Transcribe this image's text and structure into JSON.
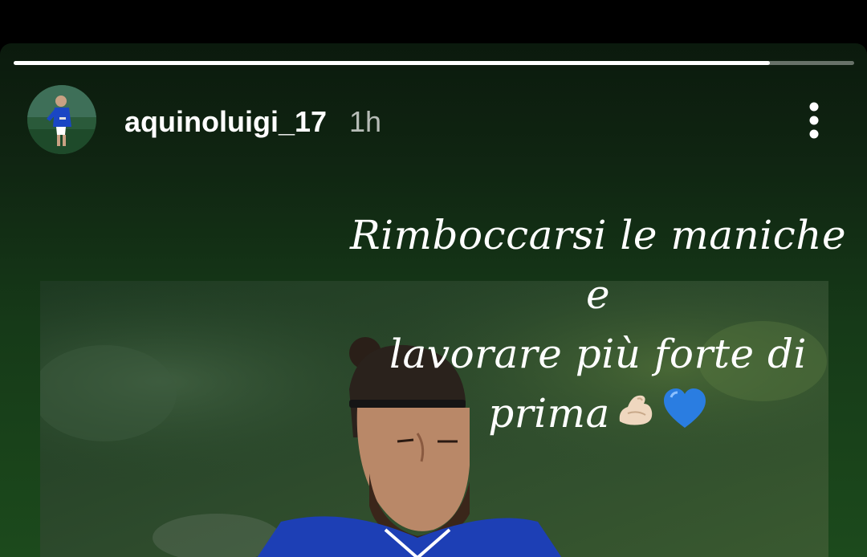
{
  "story": {
    "progress": 0.9,
    "username": "aquinoluigi_17",
    "time": "1h",
    "more_icon": "more-vertical-icon",
    "caption_lines": [
      "Rimboccarsi le maniche e",
      "lavorare più forte di",
      "prima"
    ],
    "caption_emojis": [
      "flexed-biceps-icon",
      "blue-heart-icon"
    ]
  },
  "colors": {
    "background": "#000000",
    "story_bg": "#102612",
    "text": "#ffffff"
  }
}
